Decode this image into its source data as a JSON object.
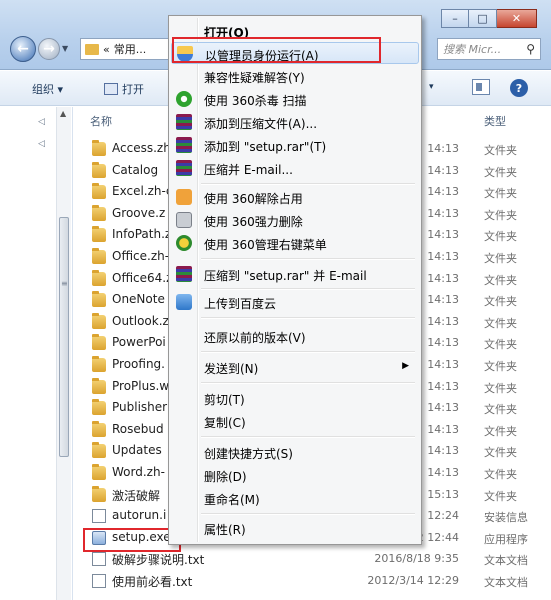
{
  "window": {
    "minimize_glyph": "–",
    "maximize_glyph": "□",
    "close_glyph": "✕"
  },
  "address": {
    "prefix": "«",
    "path": "常用..."
  },
  "search": {
    "placeholder": "搜索 Micr..."
  },
  "toolbar": {
    "organize": "组织 ▾",
    "open": "打开",
    "views_arrow": "▾",
    "help": "?"
  },
  "columns": {
    "name": "名称",
    "type": "类型"
  },
  "files": [
    {
      "icon": "folder",
      "name": "Access.zh",
      "date": "14:13",
      "type": "文件夹"
    },
    {
      "icon": "folder",
      "name": "Catalog",
      "date": "14:13",
      "type": "文件夹"
    },
    {
      "icon": "folder",
      "name": "Excel.zh-c",
      "date": "14:13",
      "type": "文件夹"
    },
    {
      "icon": "folder",
      "name": "Groove.z",
      "date": "14:13",
      "type": "文件夹"
    },
    {
      "icon": "folder",
      "name": "InfoPath.z",
      "date": "14:13",
      "type": "文件夹"
    },
    {
      "icon": "folder",
      "name": "Office.zh-",
      "date": "14:13",
      "type": "文件夹"
    },
    {
      "icon": "folder",
      "name": "Office64.z",
      "date": "14:13",
      "type": "文件夹"
    },
    {
      "icon": "folder",
      "name": "OneNote",
      "date": "14:13",
      "type": "文件夹"
    },
    {
      "icon": "folder",
      "name": "Outlook.z",
      "date": "14:13",
      "type": "文件夹"
    },
    {
      "icon": "folder",
      "name": "PowerPoi",
      "date": "14:13",
      "type": "文件夹"
    },
    {
      "icon": "folder",
      "name": "Proofing.",
      "date": "14:13",
      "type": "文件夹"
    },
    {
      "icon": "folder",
      "name": "ProPlus.w",
      "date": "14:13",
      "type": "文件夹"
    },
    {
      "icon": "folder",
      "name": "Publisher",
      "date": "14:13",
      "type": "文件夹"
    },
    {
      "icon": "folder",
      "name": "Rosebud",
      "date": "14:13",
      "type": "文件夹"
    },
    {
      "icon": "folder",
      "name": "Updates",
      "date": "14:13",
      "type": "文件夹"
    },
    {
      "icon": "folder",
      "name": "Word.zh-",
      "date": "14:13",
      "type": "文件夹"
    },
    {
      "icon": "folder",
      "name": "激活破解",
      "date": "15:13",
      "type": "文件夹"
    },
    {
      "icon": "inf",
      "name": "autorun.i",
      "date": "12:24",
      "type": "安装信息"
    },
    {
      "icon": "exe",
      "name": "setup.exe",
      "date": "2010/9/12 12:44",
      "type": "应用程序"
    },
    {
      "icon": "doc",
      "name": "破解步骤说明.txt",
      "date": "2016/8/18 9:35",
      "type": "文本文档"
    },
    {
      "icon": "doc",
      "name": "使用前必看.txt",
      "date": "2012/3/14 12:29",
      "type": "文本文档"
    }
  ],
  "context_menu": {
    "open": "打开(O)",
    "run_as_admin": "以管理员身份运行(A)",
    "compat": "兼容性疑难解答(Y)",
    "scan_360": "使用 360杀毒 扫描",
    "add_archive": "添加到压缩文件(A)...",
    "add_rar": "添加到 \"setup.rar\"(T)",
    "compress_email": "压缩并 E-mail...",
    "unlock_360": "使用 360解除占用",
    "force_delete_360": "使用 360强力删除",
    "menu_mgr_360": "使用 360管理右键菜单",
    "rar_email": "压缩到 \"setup.rar\" 并 E-mail",
    "upload_baidu": "上传到百度云",
    "restore": "还原以前的版本(V)",
    "send_to": "发送到(N)",
    "cut": "剪切(T)",
    "copy": "复制(C)",
    "shortcut": "创建快捷方式(S)",
    "delete": "删除(D)",
    "rename": "重命名(M)",
    "properties": "属性(R)",
    "submenu_arrow": "▶"
  },
  "colors": {
    "highlight_red": "#e0272c",
    "menu_hover": "#d7e6f8",
    "folder": "#e7b84a"
  }
}
